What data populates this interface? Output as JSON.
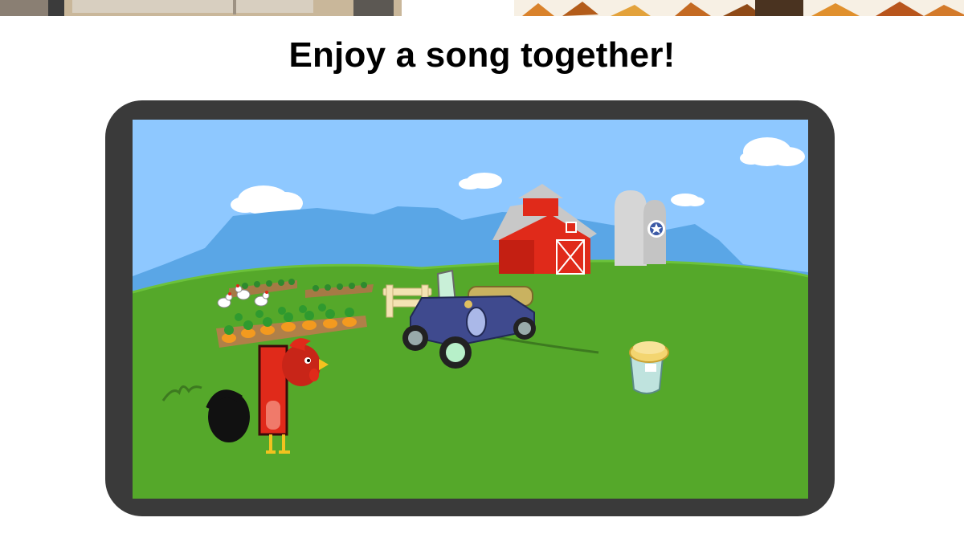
{
  "page": {
    "headline": "Enjoy a song together!"
  },
  "scene": {
    "description_icons": [
      "rooster-icon",
      "barn-icon",
      "silo-icon",
      "car-icon",
      "jar-icon",
      "chicken-icon",
      "carrot-icon"
    ]
  },
  "colors": {
    "tablet_bezel": "#3a3a3a",
    "sky": "#8ec8ff",
    "grass": "#55a82a",
    "barn_red": "#e02a1a",
    "car_blue": "#3f4a8e"
  }
}
